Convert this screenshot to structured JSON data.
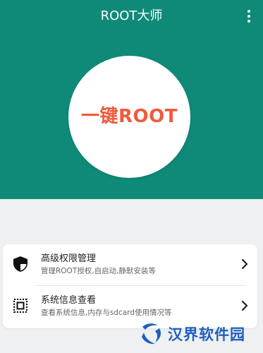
{
  "app": {
    "title": "ROOT大师"
  },
  "header": {
    "menu_icon": "more-vert-icon"
  },
  "hero": {
    "button_label": "一键ROOT",
    "button_color": "#f05a3c",
    "bg_color": "#0f8a78"
  },
  "menu": {
    "items": [
      {
        "icon": "shield-icon",
        "title": "高级权限管理",
        "description": "管理ROOT授权,自启动,静默安装等"
      },
      {
        "icon": "chip-icon",
        "title": "系统信息查看",
        "description": "查看系统信息,内存与sdcard使用情况等"
      }
    ]
  },
  "watermark": {
    "text": "汉界软件园",
    "color": "#1e5fbf"
  }
}
